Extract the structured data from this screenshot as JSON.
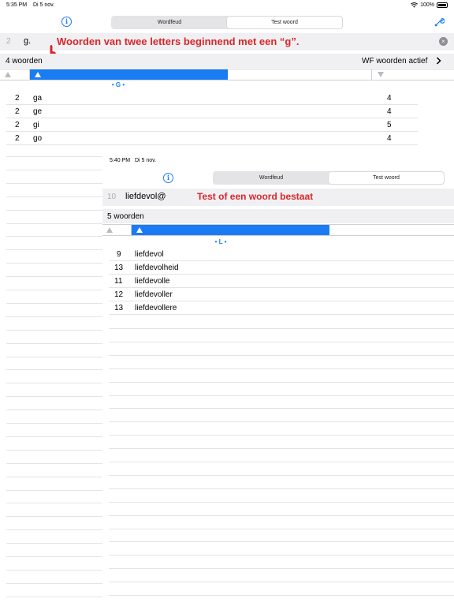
{
  "back": {
    "status": {
      "time": "5:35 PM",
      "date": "Di 5 nov.",
      "battery": "100%"
    },
    "tabs": [
      "Wordfeud",
      "Test woord"
    ],
    "search": {
      "length": "2",
      "query": "g."
    },
    "annotation": "Woorden van twee letters beginnend met een “g”.",
    "count_label": "4 woorden",
    "filter_label": "WF woorden actief",
    "section": "• G •",
    "rows": [
      {
        "len": "2",
        "word": "ga",
        "score": "4"
      },
      {
        "len": "2",
        "word": "ge",
        "score": "4"
      },
      {
        "len": "2",
        "word": "gi",
        "score": "5"
      },
      {
        "len": "2",
        "word": "go",
        "score": "4"
      }
    ]
  },
  "front": {
    "status": {
      "time": "5:40 PM",
      "date": "Di 5 nov."
    },
    "tabs": [
      "Wordfeud",
      "Test woord"
    ],
    "search": {
      "length": "10",
      "query": "liefdevol@"
    },
    "annotation": "Test of een woord bestaat",
    "count_label": "5 woorden",
    "section": "• L •",
    "rows": [
      {
        "len": "9",
        "word": "liefdevol"
      },
      {
        "len": "13",
        "word": "liefdevolheid"
      },
      {
        "len": "11",
        "word": "liefdevolle"
      },
      {
        "len": "12",
        "word": "liefdevoller"
      },
      {
        "len": "13",
        "word": "liefdevollere"
      }
    ]
  },
  "colors": {
    "accent": "#1a7cf2",
    "annotation": "#d9262b",
    "bar": "#f0f0f2"
  },
  "icons": [
    "wifi-icon",
    "battery-icon",
    "info-icon",
    "wrench-icon",
    "clear-icon",
    "chevron-right-icon",
    "sort-up-icon",
    "sort-down-icon",
    "hand-pointer-icon"
  ]
}
